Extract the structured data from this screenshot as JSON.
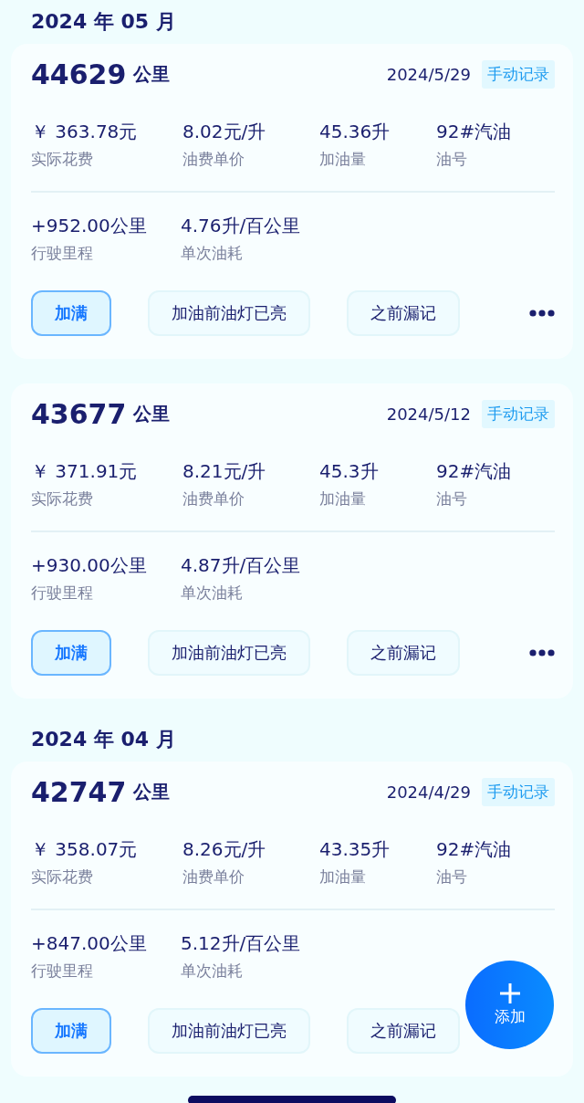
{
  "months": [
    {
      "title": "2024 年 05 月",
      "records": [
        {
          "odometer": "44629",
          "unit": "公里",
          "date": "2024/5/29",
          "source": "手动记录",
          "stats": [
            {
              "value": "￥ 363.78元",
              "label": "实际花费"
            },
            {
              "value": "8.02元/升",
              "label": "油费单价"
            },
            {
              "value": "45.36升",
              "label": "加油量"
            },
            {
              "value": "92#汽油",
              "label": "油号"
            }
          ],
          "stats2": [
            {
              "value": "+952.00公里",
              "label": "行驶里程"
            },
            {
              "value": "4.76升/百公里",
              "label": "单次油耗"
            }
          ],
          "tags": [
            {
              "label": "加满",
              "selected": true
            },
            {
              "label": "加油前油灯已亮",
              "selected": false
            },
            {
              "label": "之前漏记",
              "selected": false
            }
          ]
        },
        {
          "odometer": "43677",
          "unit": "公里",
          "date": "2024/5/12",
          "source": "手动记录",
          "stats": [
            {
              "value": "￥ 371.91元",
              "label": "实际花费"
            },
            {
              "value": "8.21元/升",
              "label": "油费单价"
            },
            {
              "value": "45.3升",
              "label": "加油量"
            },
            {
              "value": "92#汽油",
              "label": "油号"
            }
          ],
          "stats2": [
            {
              "value": "+930.00公里",
              "label": "行驶里程"
            },
            {
              "value": "4.87升/百公里",
              "label": "单次油耗"
            }
          ],
          "tags": [
            {
              "label": "加满",
              "selected": true
            },
            {
              "label": "加油前油灯已亮",
              "selected": false
            },
            {
              "label": "之前漏记",
              "selected": false
            }
          ]
        }
      ]
    },
    {
      "title": "2024 年 04 月",
      "records": [
        {
          "odometer": "42747",
          "unit": "公里",
          "date": "2024/4/29",
          "source": "手动记录",
          "stats": [
            {
              "value": "￥ 358.07元",
              "label": "实际花费"
            },
            {
              "value": "8.26元/升",
              "label": "油费单价"
            },
            {
              "value": "43.35升",
              "label": "加油量"
            },
            {
              "value": "92#汽油",
              "label": "油号"
            }
          ],
          "stats2": [
            {
              "value": "+847.00公里",
              "label": "行驶里程"
            },
            {
              "value": "5.12升/百公里",
              "label": "单次油耗"
            }
          ],
          "tags": [
            {
              "label": "加满",
              "selected": true
            },
            {
              "label": "加油前油灯已亮",
              "selected": false
            },
            {
              "label": "之前漏记",
              "selected": false
            }
          ]
        }
      ]
    }
  ],
  "fab": {
    "label": "添加"
  }
}
